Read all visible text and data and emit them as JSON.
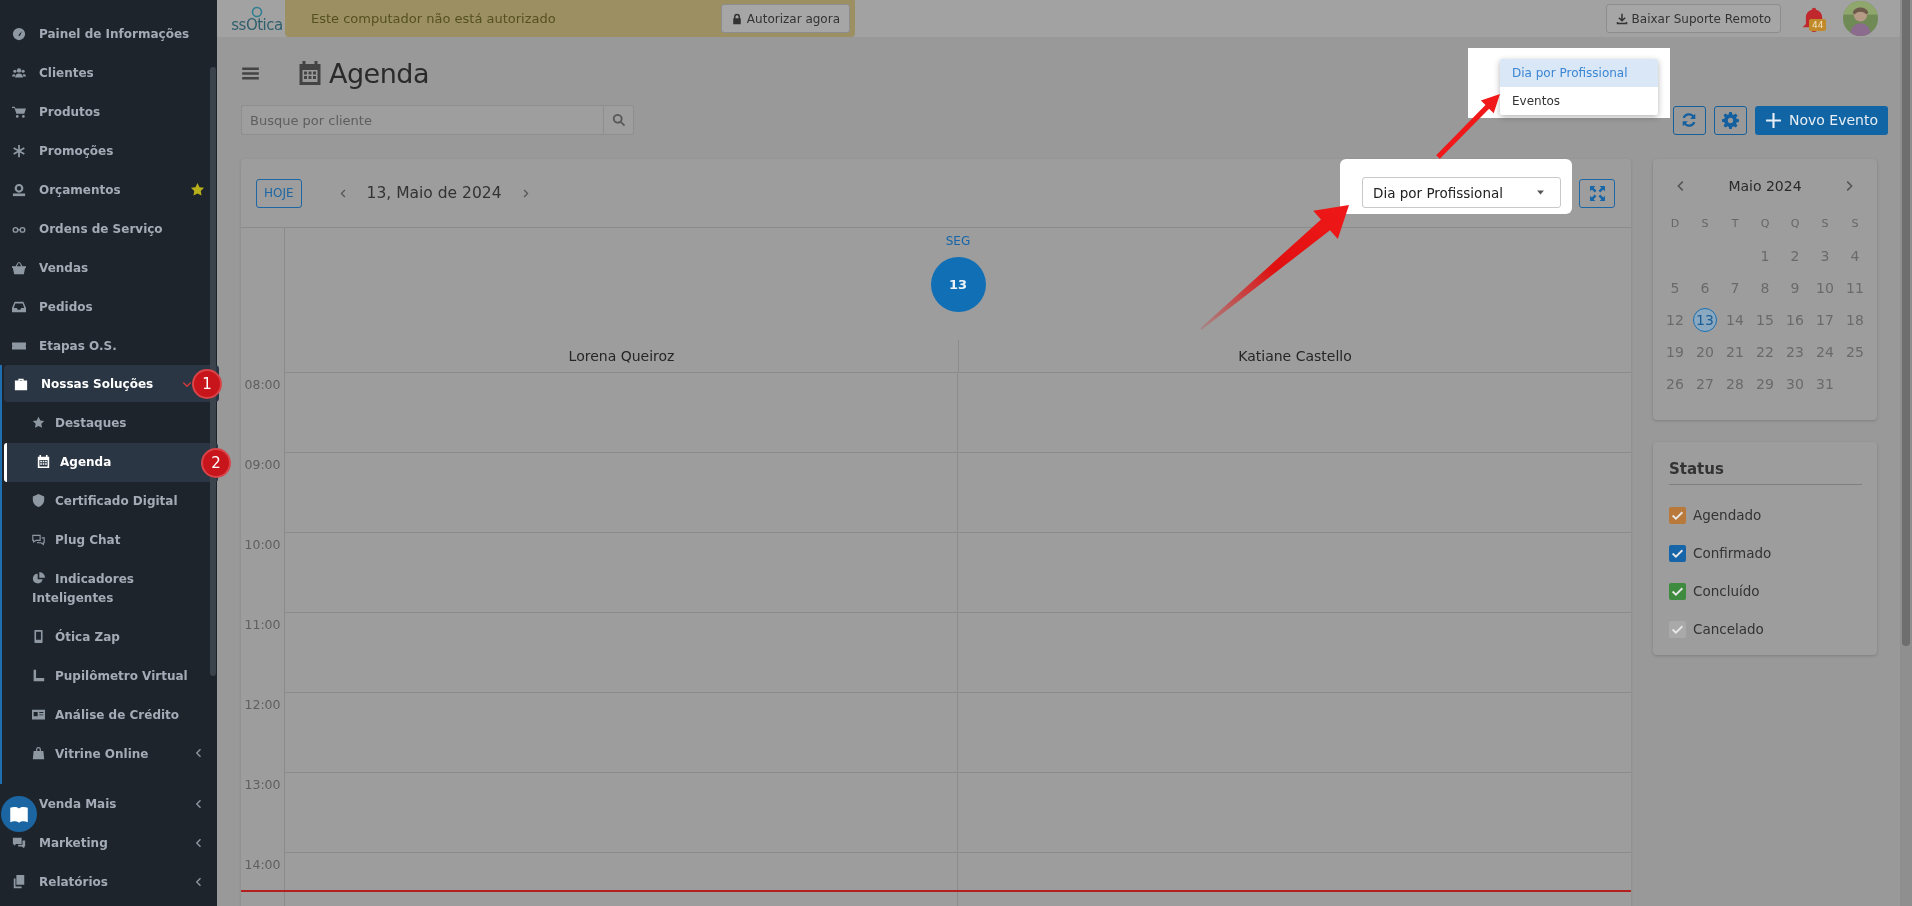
{
  "sidebar": {
    "items": [
      {
        "label": "Painel de Informações",
        "selected": false
      },
      {
        "label": "Clientes",
        "selected": false
      },
      {
        "label": "Produtos",
        "selected": false
      },
      {
        "label": "Promoções",
        "selected": false
      },
      {
        "label": "Orçamentos",
        "selected": false,
        "starred": true
      },
      {
        "label": "Ordens de Serviço",
        "selected": false
      },
      {
        "label": "Vendas",
        "selected": false
      },
      {
        "label": "Pedidos",
        "selected": false
      },
      {
        "label": "Etapas O.S.",
        "selected": false
      },
      {
        "label": "Nossas Soluções",
        "selected": true,
        "expanded": true,
        "badge": "1",
        "children": [
          {
            "label": "Destaques",
            "selected": false
          },
          {
            "label": "Agenda",
            "selected": true,
            "badge": "2"
          },
          {
            "label": "Certificado Digital",
            "selected": false
          },
          {
            "label": "Plug Chat",
            "selected": false
          },
          {
            "label": "Indicadores Inteligentes",
            "selected": false
          },
          {
            "label": "Ótica Zap",
            "selected": false
          },
          {
            "label": "Pupilômetro Virtual",
            "selected": false
          },
          {
            "label": "Análise de Crédito",
            "selected": false
          },
          {
            "label": "Vitrine Online",
            "selected": false,
            "expanded": false
          }
        ]
      },
      {
        "label": "Venda Mais",
        "selected": false,
        "expanded": false
      },
      {
        "label": "Marketing",
        "selected": false,
        "expanded": false
      },
      {
        "label": "Relatórios",
        "selected": false,
        "expanded": false
      }
    ]
  },
  "topbar": {
    "logo": "ssOtica",
    "banner": {
      "text": "Este computador não está autorizado",
      "button": "Autorizar agora"
    },
    "remote_support_button": "Baixar Suporte Remoto",
    "notifications": {
      "count": "44"
    }
  },
  "page": {
    "title": "Agenda",
    "search": {
      "placeholder": "Busque por cliente"
    },
    "new_event_button": "Novo Evento"
  },
  "calendar": {
    "today_button": "HOJE",
    "date": "13, Maio de 2024",
    "view_select": {
      "value": "Dia por Profissional"
    },
    "view_menu": {
      "options": [
        {
          "label": "Dia por Profissional",
          "selected": true
        },
        {
          "label": "Eventos",
          "selected": false
        }
      ]
    },
    "day": {
      "weekday": "SEG",
      "number": "13"
    },
    "professionals": [
      "Lorena Queiroz",
      "Katiane Castello"
    ],
    "times": [
      "08:00",
      "09:00",
      "10:00",
      "11:00",
      "12:00",
      "13:00",
      "14:00"
    ]
  },
  "mini_calendar": {
    "title": "Maio 2024",
    "weekdays": [
      "D",
      "S",
      "T",
      "Q",
      "Q",
      "S",
      "S"
    ],
    "weeks": [
      [
        {
          "day": "1",
          "selected": false
        },
        {
          "day": "2",
          "selected": false
        },
        {
          "day": "3",
          "selected": false
        },
        {
          "day": "4",
          "selected": false
        }
      ],
      [
        {
          "day": "5",
          "selected": false
        },
        {
          "day": "6",
          "selected": false
        },
        {
          "day": "7",
          "selected": false
        },
        {
          "day": "8",
          "selected": false
        },
        {
          "day": "9",
          "selected": false
        },
        {
          "day": "10",
          "selected": false
        },
        {
          "day": "11",
          "selected": false
        }
      ],
      [
        {
          "day": "12",
          "selected": false
        },
        {
          "day": "13",
          "selected": true
        },
        {
          "day": "14",
          "selected": false
        },
        {
          "day": "15",
          "selected": false
        },
        {
          "day": "16",
          "selected": false
        },
        {
          "day": "17",
          "selected": false
        },
        {
          "day": "18",
          "selected": false
        }
      ],
      [
        {
          "day": "19",
          "selected": false
        },
        {
          "day": "20",
          "selected": false
        },
        {
          "day": "21",
          "selected": false
        },
        {
          "day": "22",
          "selected": false
        },
        {
          "day": "23",
          "selected": false
        },
        {
          "day": "24",
          "selected": false
        },
        {
          "day": "25",
          "selected": false
        }
      ],
      [
        {
          "day": "26",
          "selected": false
        },
        {
          "day": "27",
          "selected": false
        },
        {
          "day": "28",
          "selected": false
        },
        {
          "day": "29",
          "selected": false
        },
        {
          "day": "30",
          "selected": false
        },
        {
          "day": "31",
          "selected": false
        }
      ]
    ]
  },
  "status": {
    "title": "Status",
    "items": [
      {
        "label": "Agendado",
        "checked": true,
        "color": "#b8793a"
      },
      {
        "label": "Confirmado",
        "checked": true,
        "color": "#1565a8"
      },
      {
        "label": "Concluído",
        "checked": true,
        "color": "#3e8a3e"
      },
      {
        "label": "Cancelado",
        "checked": true,
        "color": "#a9a9a9"
      }
    ]
  }
}
